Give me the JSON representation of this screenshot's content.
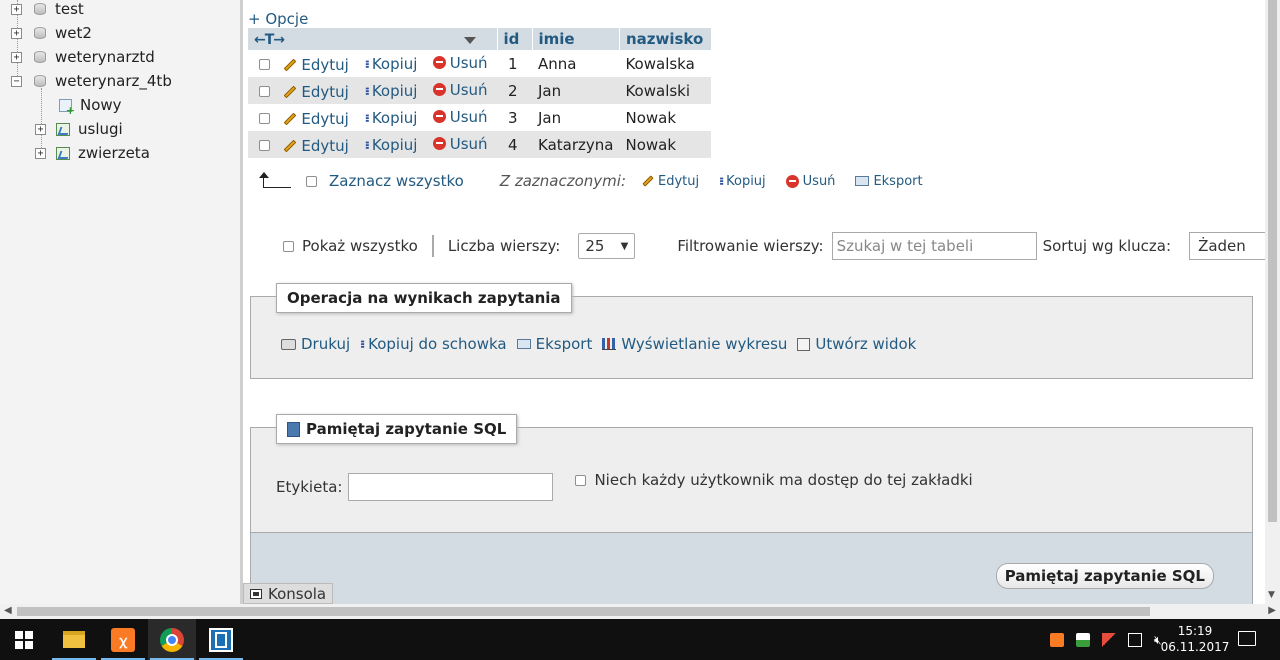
{
  "nav": {
    "databases": [
      {
        "name": "test",
        "expander": "+"
      },
      {
        "name": "wet2",
        "expander": "+"
      },
      {
        "name": "weterynarztd",
        "expander": "+"
      },
      {
        "name": "weterynarz_4tb",
        "expander": "−"
      }
    ],
    "children": [
      {
        "name": "Nowy"
      },
      {
        "name": "uslugi"
      },
      {
        "name": "zwierzeta"
      }
    ]
  },
  "main": {
    "options_link": "+ Opcje",
    "columns": {
      "arrows": "←T→",
      "id": "id",
      "imie": "imie",
      "nazwisko": "nazwisko"
    },
    "row_actions": {
      "edit": "Edytuj",
      "copy": "Kopiuj",
      "delete": "Usuń"
    },
    "rows": [
      {
        "id": "1",
        "imie": "Anna",
        "nazwisko": "Kowalska"
      },
      {
        "id": "2",
        "imie": "Jan",
        "nazwisko": "Kowalski"
      },
      {
        "id": "3",
        "imie": "Jan",
        "nazwisko": "Nowak"
      },
      {
        "id": "4",
        "imie": "Katarzyna",
        "nazwisko": "Nowak"
      }
    ],
    "bulk": {
      "select_all": "Zaznacz wszystko",
      "with_selected": "Z zaznaczonymi:",
      "edit": "Edytuj",
      "copy": "Kopiuj",
      "delete": "Usuń",
      "export": "Eksport"
    },
    "navigation": {
      "show_all": "Pokaż wszystko",
      "rows_label": "Liczba wierszy:",
      "rows_value": "25",
      "filter_label": "Filtrowanie wierszy:",
      "filter_placeholder": "Szukaj w tej tabeli",
      "sort_label": "Sortuj wg klucza:",
      "sort_value": "Żaden"
    },
    "query_ops": {
      "legend": "Operacja na wynikach zapytania",
      "print": "Drukuj",
      "copy_clipboard": "Kopiuj do schowka",
      "export": "Eksport",
      "chart": "Wyświetlanie wykresu",
      "create_view": "Utwórz widok"
    },
    "bookmark": {
      "legend": "Pamiętaj zapytanie SQL",
      "label": "Etykieta:",
      "shared_label": "Niech każdy użytkownik ma dostęp do tej zakładki",
      "submit": "Pamiętaj zapytanie SQL"
    },
    "console": "Konsola"
  },
  "taskbar": {
    "time": "15:19",
    "date": "06.11.2017",
    "xampp_label": "ꭓ"
  }
}
